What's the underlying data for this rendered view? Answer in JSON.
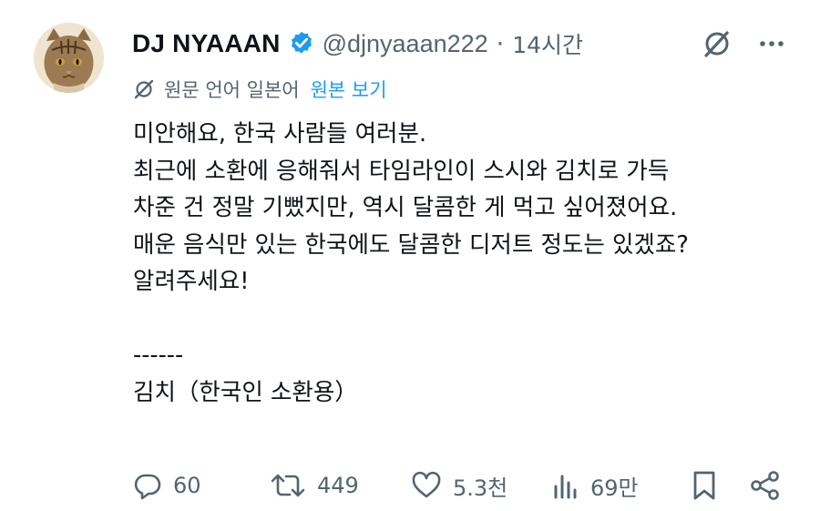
{
  "tweet": {
    "display_name": "DJ NYAAAN",
    "handle": "@djnyaaan222",
    "separator": "·",
    "time": "14시간",
    "translation": {
      "notice": "원문 언어 일본어",
      "link": "원본 보기"
    },
    "body": {
      "lines": [
        "미안해요, 한국 사람들 여러분.",
        "최근에 소환에 응해줘서 타임라인이 스시와 김치로 가득",
        "차준 건 정말 기뻤지만, 역시 달콤한 게 먹고 싶어졌어요.",
        "매운 음식만 있는 한국에도 달콤한 디저트 정도는 있겠죠?",
        "알려주세요!",
        "",
        "------",
        "김치（한국인 소환용）"
      ]
    },
    "stats": {
      "replies": "60",
      "reposts": "449",
      "likes": "5.3천",
      "views": "69만"
    },
    "colors": {
      "text": "#0f1419",
      "secondary": "#536471",
      "accent": "#1d9bf0"
    },
    "icons": [
      "verified-badge-icon",
      "grok-icon",
      "more-icon",
      "translate-icon",
      "reply-icon",
      "repost-icon",
      "like-icon",
      "views-icon",
      "bookmark-icon",
      "share-icon"
    ]
  }
}
